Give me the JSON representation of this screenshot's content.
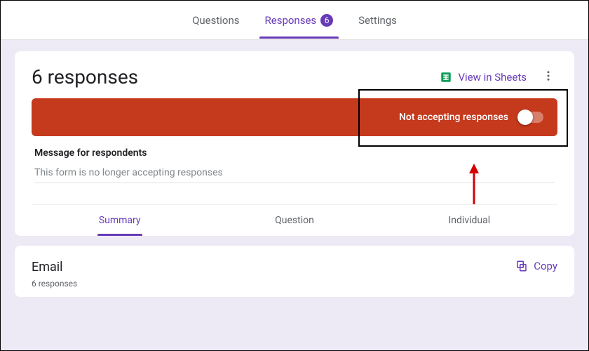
{
  "tabs": {
    "questions": "Questions",
    "responses": "Responses",
    "responses_count": "6",
    "settings": "Settings"
  },
  "responses_card": {
    "title": "6 responses",
    "view_in_sheets": "View in Sheets",
    "toggle_label": "Not accepting responses",
    "message_label": "Message for respondents",
    "message_value": "This form is no longer accepting responses",
    "subtabs": {
      "summary": "Summary",
      "question": "Question",
      "individual": "Individual"
    }
  },
  "email_card": {
    "title": "Email",
    "subtitle": "6 responses",
    "copy_label": "Copy"
  }
}
